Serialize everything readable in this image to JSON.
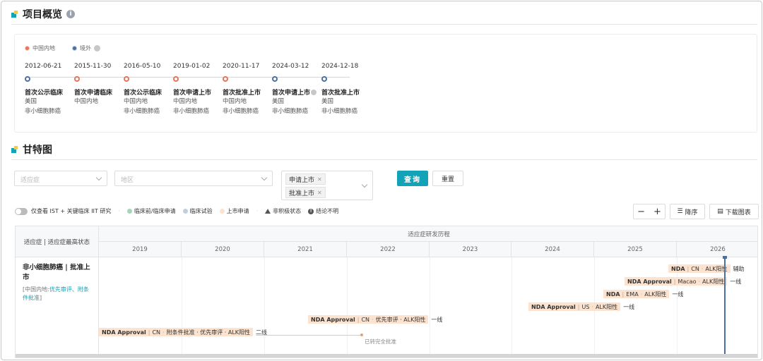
{
  "overview": {
    "title": "项目概览",
    "legend": {
      "domestic": "中国内地",
      "overseas": "境外"
    },
    "milestones": [
      {
        "date": "2012-06-21",
        "title": "首次公示临床",
        "region": "美国",
        "indication": "非小细胞肺癌",
        "type": "overseas"
      },
      {
        "date": "2015-11-30",
        "title": "首次申请临床",
        "region": "中国内地",
        "indication": "",
        "type": "domestic"
      },
      {
        "date": "2016-05-10",
        "title": "首次公示临床",
        "region": "中国内地",
        "indication": "非小细胞肺癌",
        "type": "domestic"
      },
      {
        "date": "2019-01-02",
        "title": "首次申请上市",
        "region": "中国内地",
        "indication": "非小细胞肺癌",
        "type": "domestic"
      },
      {
        "date": "2020-11-17",
        "title": "首次批准上市",
        "region": "中国内地",
        "indication": "非小细胞肺癌",
        "type": "domestic"
      },
      {
        "date": "2024-03-12",
        "title": "首次申请上市",
        "region": "美国",
        "indication": "非小细胞肺癌",
        "type": "overseas"
      },
      {
        "date": "2024-12-18",
        "title": "首次批准上市",
        "region": "美国",
        "indication": "非小细胞肺癌",
        "type": "overseas"
      }
    ]
  },
  "gantt": {
    "title": "甘特图",
    "filters": {
      "indication_placeholder": "适应症",
      "region_placeholder": "地区",
      "status_tags": [
        "申请上市",
        "批准上市"
      ]
    },
    "buttons": {
      "query": "查询",
      "reset": "重置",
      "minus": "−",
      "plus": "+",
      "sort": "降序",
      "download": "下载图表"
    },
    "legend": {
      "toggle_label": "仅查看 IST + 关键临床 IIT 研究",
      "preclinical": "临床前/临床申请",
      "trial": "临床试验",
      "submission": "上市申请",
      "inactive": "非积极状态",
      "unclear": "结论不明"
    },
    "header": {
      "left": "适应症 | 适应症最高状态",
      "top": "适应症研发历程"
    },
    "years": [
      "2019",
      "2020",
      "2021",
      "2022",
      "2023",
      "2024",
      "2025",
      "2026"
    ],
    "indication": {
      "title": "非小细胞肺癌 | 批准上市",
      "sub_prefix": "[中国内地:",
      "sub_tags": "优先审评、附条件批准",
      "sub_suffix": "]"
    },
    "bars": [
      {
        "name": "NDA",
        "region": "CN",
        "tags": "ALK阳性",
        "line": "辅助"
      },
      {
        "name": "NDA Approval",
        "region": "Macao",
        "tags": "ALK阳性",
        "line": "一线"
      },
      {
        "name": "NDA",
        "region": "EMA",
        "tags": "ALK阳性",
        "line": "一线"
      },
      {
        "name": "NDA Approval",
        "region": "US",
        "tags": "ALK阳性",
        "line": "一线"
      },
      {
        "name": "NDA Approval",
        "region": "CN",
        "tags": "优先审评 · ALK阳性",
        "line": "一线"
      },
      {
        "name": "NDA Approval",
        "region": "CN",
        "tags": "附条件批准 · 优先审评 · ALK阳性",
        "line": "二线"
      }
    ],
    "annotation": "已转完全批准"
  },
  "colors": {
    "accent": "#12a3b8",
    "domestic": "#e8725b",
    "overseas": "#4b6f9e",
    "bar": "#fbe3cf"
  }
}
